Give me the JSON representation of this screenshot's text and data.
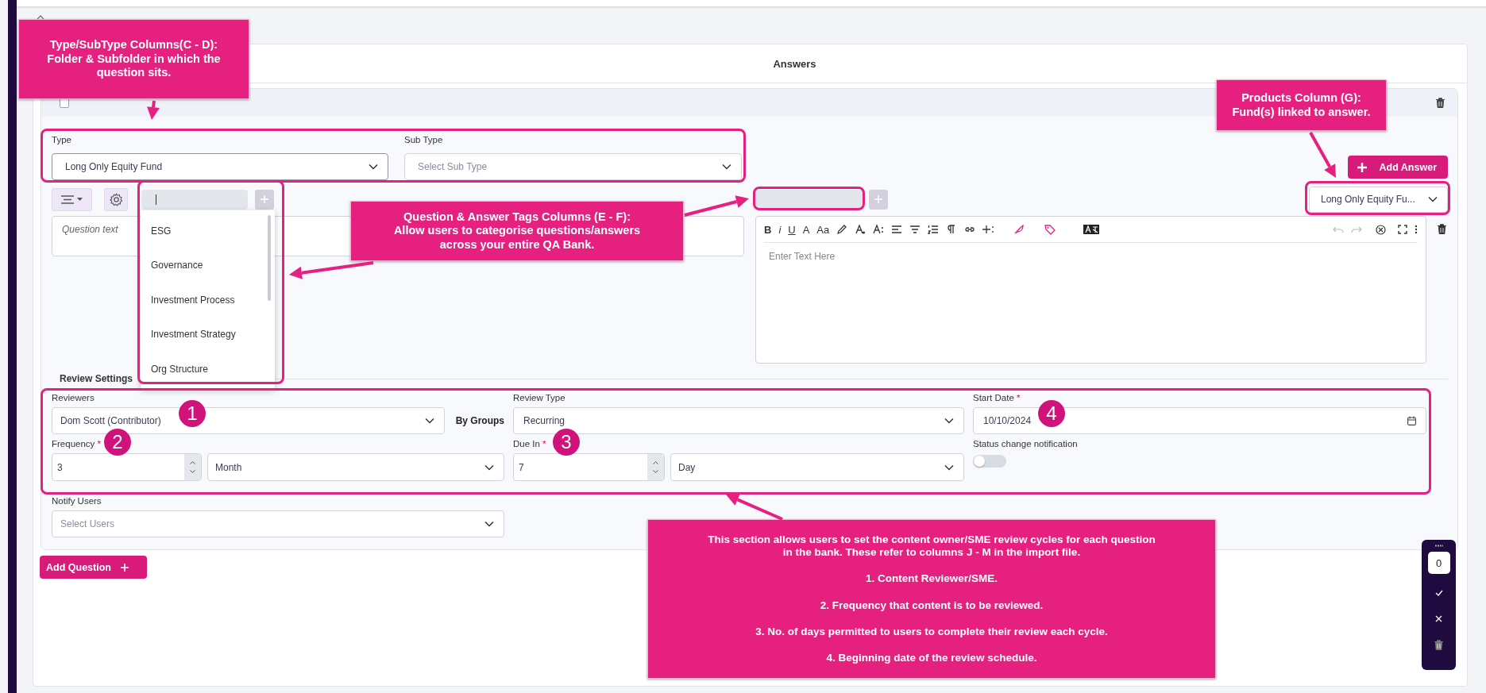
{
  "header": {
    "title": "Answers"
  },
  "question": {
    "checked": false,
    "type_field": {
      "label": "Type",
      "value": "Long Only Equity Fund"
    },
    "sub_type_field": {
      "label": "Sub Type",
      "placeholder": "Select Sub Type"
    },
    "question_field": {
      "placeholder": "Question text"
    },
    "tag_options": [
      {
        "label": "ESG"
      },
      {
        "label": "Governance"
      },
      {
        "label": "Investment Process"
      },
      {
        "label": "Investment Strategy"
      },
      {
        "label": "Org Structure"
      }
    ],
    "add_answer_button": {
      "label": "Add Answer"
    },
    "products_select": {
      "value": "Long Only Equity Fu..."
    },
    "editor": {
      "toolbar_texts": [
        "B",
        "i",
        "U",
        "A",
        "Aa"
      ],
      "placeholder": "Enter Text Here"
    }
  },
  "review_settings": {
    "title": "Review Settings",
    "reviewers": {
      "label": "Reviewers",
      "value": "Dom Scott (Contributor)"
    },
    "by_groups": "By Groups",
    "review_type": {
      "label": "Review Type",
      "value": "Recurring"
    },
    "start_date": {
      "label": "Start Date",
      "required_mark": "*",
      "value": "10/10/2024"
    },
    "frequency": {
      "label": "Frequency",
      "required_mark": "*",
      "value": "3",
      "unit": "Month"
    },
    "due_in": {
      "label": "Due In",
      "required_mark": "*",
      "value": "7",
      "unit": "Day"
    },
    "status_notification": {
      "label": "Status change notification",
      "on": false
    },
    "notify_users": {
      "label": "Notify Users",
      "placeholder": "Select Users"
    }
  },
  "add_question_button": {
    "label": "Add Question"
  },
  "side_panel": {
    "count": "0"
  },
  "annotations": {
    "callouts": [
      {
        "paragraphs": [
          "Type/SubType Columns(C - D):\nFolder & Subfolder in which the\nquestion sits."
        ]
      },
      {
        "paragraphs": [
          "Products Column (G):\nFund(s) linked to answer."
        ]
      },
      {
        "paragraphs": [
          "Question & Answer Tags Columns (E - F):\nAllow users to categorise questions/answers\nacross your entire QA Bank."
        ]
      },
      {
        "paragraphs": [
          "This section allows users to set the content owner/SME review cycles for each question\nin the bank. These refer to columns J - M in the import file.",
          "1. Content Reviewer/SME.",
          "2. Frequency that content is to be reviewed.",
          "3. No. of days permitted to users to complete their review each cycle.",
          "4. Beginning date of the review schedule."
        ]
      }
    ],
    "markers": [
      "1",
      "2",
      "3",
      "4"
    ]
  }
}
